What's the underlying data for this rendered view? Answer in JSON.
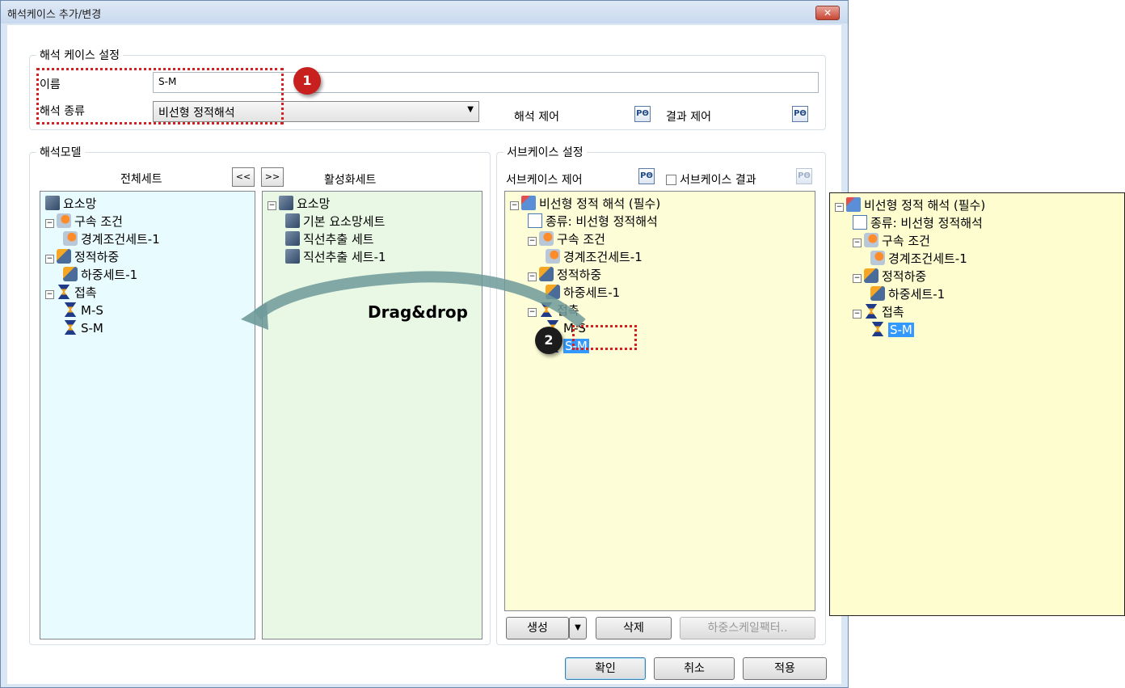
{
  "window": {
    "title": "해석케이스 추가/변경",
    "close_glyph": "✕"
  },
  "case_settings": {
    "legend": "해석 케이스 설정",
    "name_label": "이름",
    "name_value": "S-M",
    "type_label": "해석 종류",
    "type_value": "비선형 정적해석",
    "analysis_control_label": "해석 제어",
    "result_control_label": "결과 제어"
  },
  "model": {
    "legend": "해석모델",
    "all_sets_header": "전체세트",
    "move_left": "<<",
    "move_right": ">>",
    "active_sets_header": "활성화세트",
    "all_tree": [
      {
        "label": "요소망",
        "icon": "mesh-icon"
      },
      {
        "label": "구속 조건",
        "icon": "boundary-condition-icon"
      },
      {
        "label": "경계조건세트-1",
        "icon": "boundary-condition-icon"
      },
      {
        "label": "정적하중",
        "icon": "static-load-icon"
      },
      {
        "label": "하중세트-1",
        "icon": "static-load-icon"
      },
      {
        "label": "접촉",
        "icon": "contact-icon"
      },
      {
        "label": "M-S",
        "icon": "contact-icon"
      },
      {
        "label": "S-M",
        "icon": "contact-icon"
      }
    ],
    "active_tree": [
      {
        "label": "요소망",
        "icon": "mesh-icon"
      },
      {
        "label": "기본 요소망세트",
        "icon": "mesh-icon"
      },
      {
        "label": "직선추출 세트",
        "icon": "mesh-icon"
      },
      {
        "label": "직선추출 세트-1",
        "icon": "mesh-icon"
      }
    ]
  },
  "subcase": {
    "legend": "서브케이스 설정",
    "control_label": "서브케이스 제어",
    "result_label": "서브케이스 결과",
    "result_checked": false,
    "tree": [
      {
        "label": "비선형 정적 해석 (필수)",
        "icon": "analysis-case-icon"
      },
      {
        "label": "종류: 비선형 정적해석",
        "icon": "document-icon"
      },
      {
        "label": "구속 조건",
        "icon": "boundary-condition-icon"
      },
      {
        "label": "경계조건세트-1",
        "icon": "boundary-condition-icon"
      },
      {
        "label": "정적하중",
        "icon": "static-load-icon"
      },
      {
        "label": "하중세트-1",
        "icon": "static-load-icon"
      },
      {
        "label": "접촉",
        "icon": "contact-icon"
      },
      {
        "label": "M-S",
        "icon": "contact-icon"
      },
      {
        "label": "S-M",
        "icon": "contact-icon",
        "selected": true
      }
    ],
    "create_label": "생성",
    "delete_label": "삭제",
    "scale_label": "하중스케일팩터.."
  },
  "footer": {
    "ok": "확인",
    "cancel": "취소",
    "apply": "적용"
  },
  "annotations": {
    "drag_text": "Drag&drop",
    "badge1": "1",
    "badge2": "2"
  },
  "result_tree": [
    {
      "label": "비선형 정적 해석 (필수)",
      "icon": "analysis-case-icon"
    },
    {
      "label": "종류: 비선형 정적해석",
      "icon": "document-icon"
    },
    {
      "label": "구속 조건",
      "icon": "boundary-condition-icon"
    },
    {
      "label": "경계조건세트-1",
      "icon": "boundary-condition-icon"
    },
    {
      "label": "정적하중",
      "icon": "static-load-icon"
    },
    {
      "label": "하중세트-1",
      "icon": "static-load-icon"
    },
    {
      "label": "접촉",
      "icon": "contact-icon"
    },
    {
      "label": "S-M",
      "icon": "contact-icon",
      "selected": true
    }
  ],
  "colors": {
    "model_all_bg": "#e8fbff",
    "model_active_bg": "#e8f8e4",
    "subcase_bg": "#fdfdd8",
    "result_bg": "#fdfdd0",
    "selection": "#3399ff",
    "marker_red": "#d42020",
    "badge_red": "#c8201e",
    "badge_dark": "#1c1c1c",
    "arrow": "#6f9a9a"
  }
}
